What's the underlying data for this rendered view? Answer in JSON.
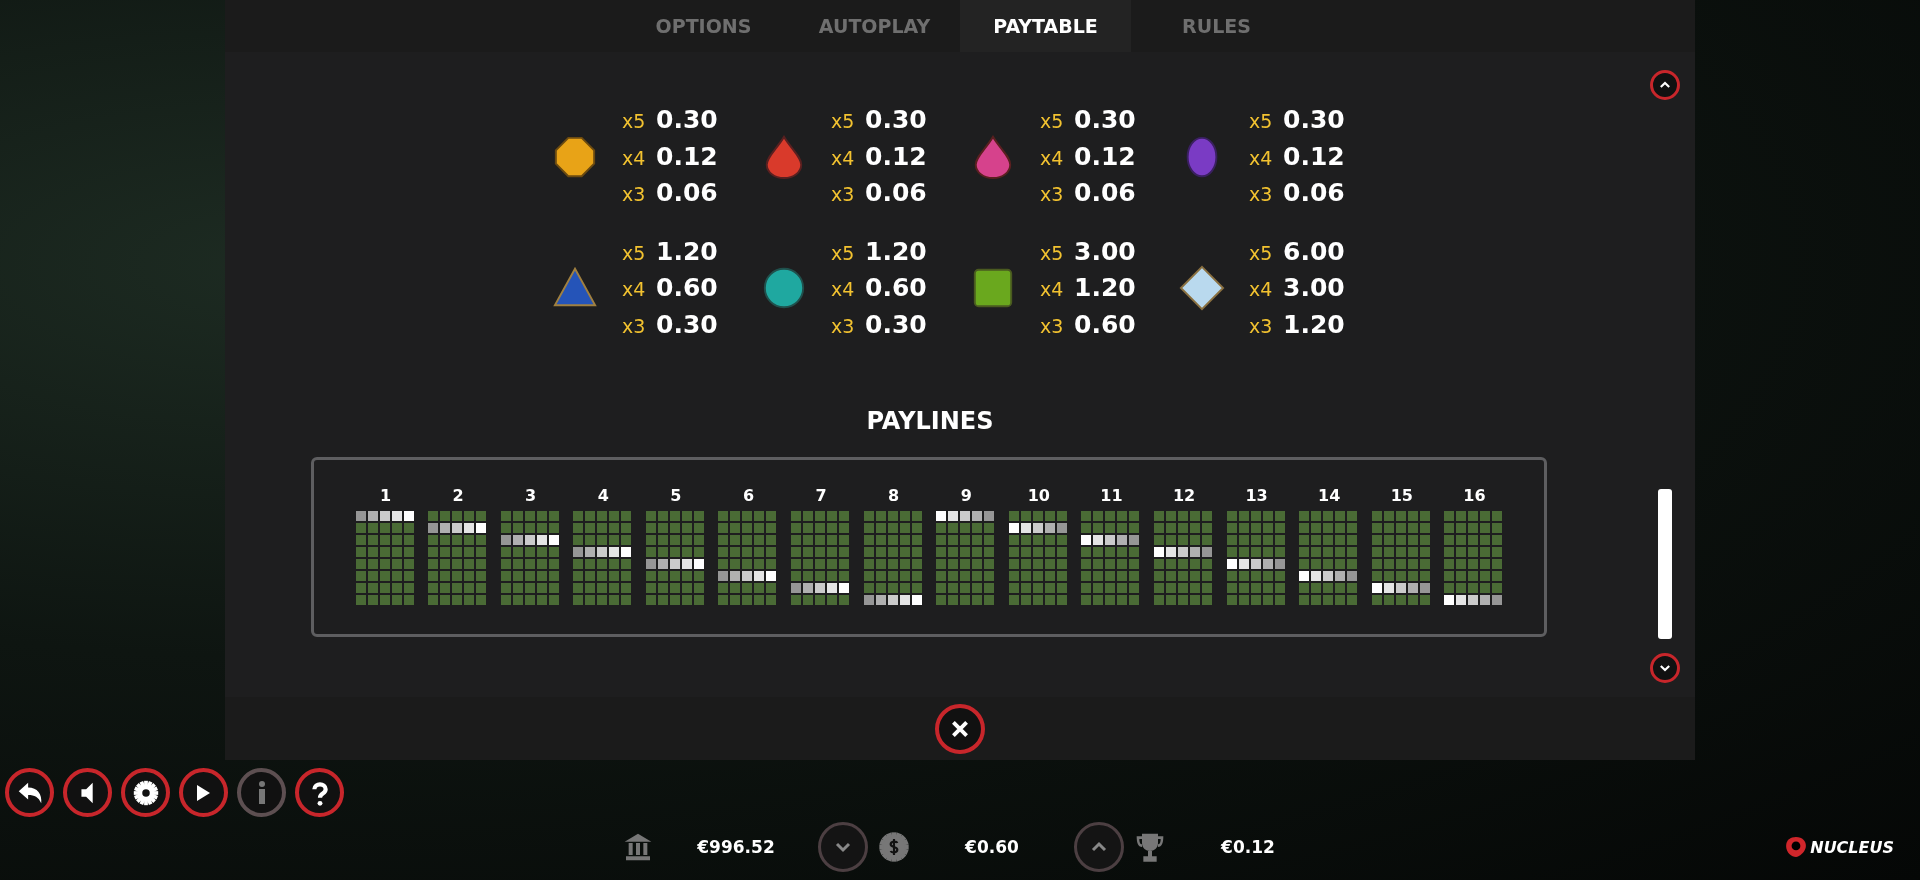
{
  "tabs": [
    {
      "label": "OPTIONS",
      "selected": false
    },
    {
      "label": "AUTOPLAY",
      "selected": false
    },
    {
      "label": "PAYTABLE",
      "selected": true
    },
    {
      "label": "RULES",
      "selected": false
    }
  ],
  "symbols": [
    {
      "kind": "octagon",
      "color": "#e8a317",
      "pays": [
        {
          "mult": "x5",
          "value": "0.30"
        },
        {
          "mult": "x4",
          "value": "0.12"
        },
        {
          "mult": "x3",
          "value": "0.06"
        }
      ]
    },
    {
      "kind": "drop",
      "color": "#d93a2b",
      "pays": [
        {
          "mult": "x5",
          "value": "0.30"
        },
        {
          "mult": "x4",
          "value": "0.12"
        },
        {
          "mult": "x3",
          "value": "0.06"
        }
      ]
    },
    {
      "kind": "drop",
      "color": "#d6428c",
      "pays": [
        {
          "mult": "x5",
          "value": "0.30"
        },
        {
          "mult": "x4",
          "value": "0.12"
        },
        {
          "mult": "x3",
          "value": "0.06"
        }
      ]
    },
    {
      "kind": "oval",
      "color": "#7a3bc4",
      "pays": [
        {
          "mult": "x5",
          "value": "0.30"
        },
        {
          "mult": "x4",
          "value": "0.12"
        },
        {
          "mult": "x3",
          "value": "0.06"
        }
      ]
    },
    {
      "kind": "triangle",
      "color": "#2554b8",
      "pays": [
        {
          "mult": "x5",
          "value": "1.20"
        },
        {
          "mult": "x4",
          "value": "0.60"
        },
        {
          "mult": "x3",
          "value": "0.30"
        }
      ]
    },
    {
      "kind": "round",
      "color": "#1fa8a0",
      "pays": [
        {
          "mult": "x5",
          "value": "1.20"
        },
        {
          "mult": "x4",
          "value": "0.60"
        },
        {
          "mult": "x3",
          "value": "0.30"
        }
      ]
    },
    {
      "kind": "square",
      "color": "#6aa81e",
      "pays": [
        {
          "mult": "x5",
          "value": "3.00"
        },
        {
          "mult": "x4",
          "value": "1.20"
        },
        {
          "mult": "x3",
          "value": "0.60"
        }
      ]
    },
    {
      "kind": "diamond",
      "color": "#b9d9ee",
      "pays": [
        {
          "mult": "x5",
          "value": "6.00"
        },
        {
          "mult": "x4",
          "value": "3.00"
        },
        {
          "mult": "x3",
          "value": "1.20"
        }
      ]
    }
  ],
  "paylines_title": "PAYLINES",
  "paylines": [
    {
      "label": "1",
      "kind": "fade-left",
      "lit_rows": [
        true,
        false,
        false,
        false,
        false,
        false,
        false,
        false
      ]
    },
    {
      "label": "2",
      "kind": "fade-left",
      "lit_rows": [
        false,
        true,
        false,
        false,
        false,
        false,
        false,
        false
      ]
    },
    {
      "label": "3",
      "kind": "fade-left",
      "lit_rows": [
        false,
        false,
        true,
        false,
        false,
        false,
        false,
        false
      ]
    },
    {
      "label": "4",
      "kind": "fade-left",
      "lit_rows": [
        false,
        false,
        false,
        true,
        false,
        false,
        false,
        false
      ]
    },
    {
      "label": "5",
      "kind": "fade-left",
      "lit_rows": [
        false,
        false,
        false,
        false,
        true,
        false,
        false,
        false
      ]
    },
    {
      "label": "6",
      "kind": "fade-left",
      "lit_rows": [
        false,
        false,
        false,
        false,
        false,
        true,
        false,
        false
      ]
    },
    {
      "label": "7",
      "kind": "fade-left",
      "lit_rows": [
        false,
        false,
        false,
        false,
        false,
        false,
        true,
        false
      ]
    },
    {
      "label": "8",
      "kind": "fade-left",
      "lit_rows": [
        false,
        false,
        false,
        false,
        false,
        false,
        false,
        true
      ]
    },
    {
      "label": "9",
      "kind": "fade-right",
      "lit_rows": [
        true,
        false,
        false,
        false,
        false,
        false,
        false,
        false
      ]
    },
    {
      "label": "10",
      "kind": "fade-right",
      "lit_rows": [
        false,
        true,
        false,
        false,
        false,
        false,
        false,
        false
      ]
    },
    {
      "label": "11",
      "kind": "fade-right",
      "lit_rows": [
        false,
        false,
        true,
        false,
        false,
        false,
        false,
        false
      ]
    },
    {
      "label": "12",
      "kind": "fade-right",
      "lit_rows": [
        false,
        false,
        false,
        true,
        false,
        false,
        false,
        false
      ]
    },
    {
      "label": "13",
      "kind": "fade-right",
      "lit_rows": [
        false,
        false,
        false,
        false,
        true,
        false,
        false,
        false
      ]
    },
    {
      "label": "14",
      "kind": "fade-right",
      "lit_rows": [
        false,
        false,
        false,
        false,
        false,
        true,
        false,
        false
      ]
    },
    {
      "label": "15",
      "kind": "fade-right",
      "lit_rows": [
        false,
        false,
        false,
        false,
        false,
        false,
        true,
        false
      ]
    },
    {
      "label": "16",
      "kind": "fade-right",
      "lit_rows": [
        false,
        false,
        false,
        false,
        false,
        false,
        false,
        true
      ]
    }
  ],
  "controls": [
    {
      "kind": "back",
      "disabled": false
    },
    {
      "kind": "sound",
      "disabled": false
    },
    {
      "kind": "settings",
      "disabled": false
    },
    {
      "kind": "autoplay",
      "disabled": false
    },
    {
      "kind": "info",
      "disabled": true
    },
    {
      "kind": "help",
      "disabled": false
    }
  ],
  "status": {
    "balance": "€996.52",
    "bet": "€0.60",
    "win": "€0.12"
  },
  "brand": "NUCLEUS"
}
